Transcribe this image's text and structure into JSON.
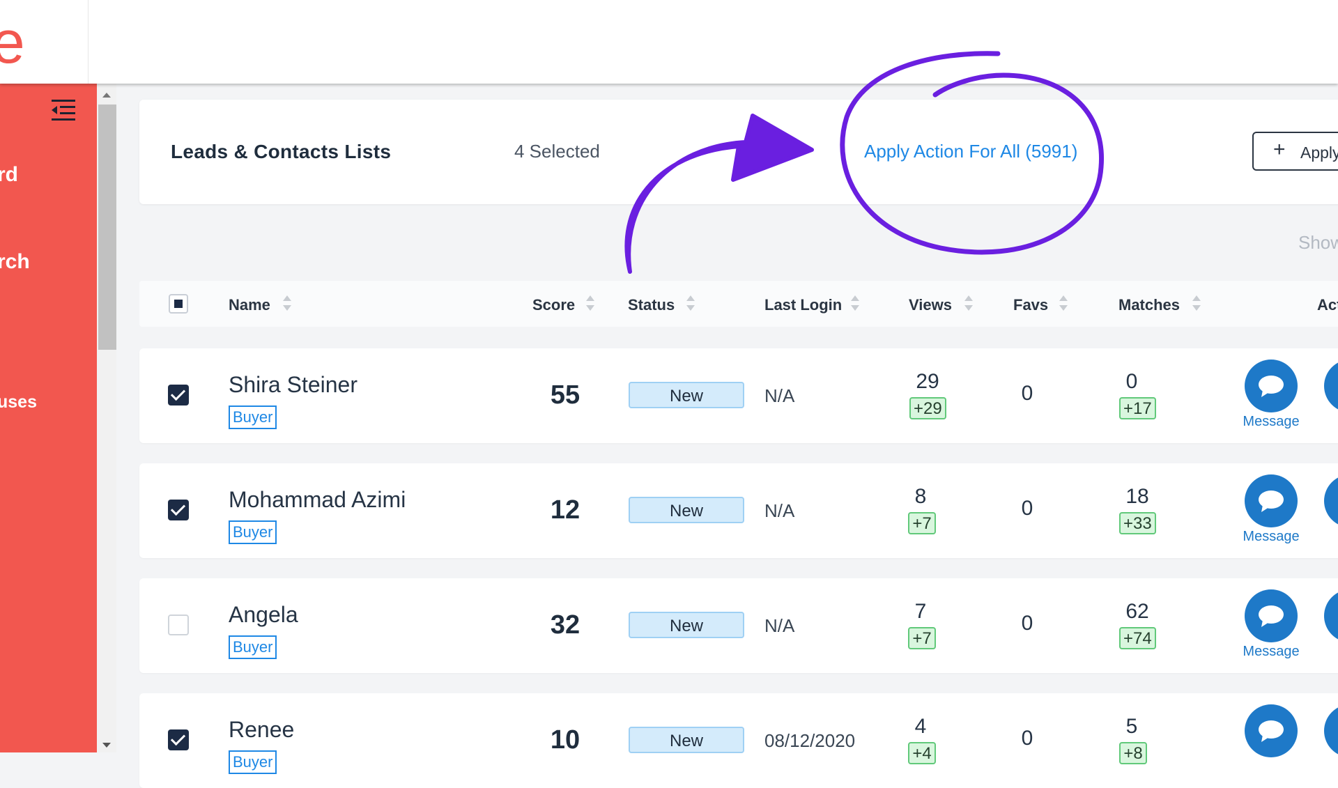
{
  "logo": {
    "text": "te"
  },
  "sidebar": {
    "items": [
      {
        "label": "rd"
      },
      {
        "label": "rch"
      },
      {
        "label": "uses"
      }
    ]
  },
  "header": {
    "title": "Leads & Contacts Lists",
    "selected": "4 Selected",
    "apply_all": "Apply Action For All (5991)",
    "apply_button": "Apply",
    "show": "Show"
  },
  "table": {
    "columns": [
      "Name",
      "Score",
      "Status",
      "Last Login",
      "Views",
      "Favs",
      "Matches",
      "Act"
    ],
    "message_label": "Message",
    "rows": [
      {
        "name": "Shira Steiner",
        "tag": "Buyer",
        "score": "55",
        "status": "New",
        "last_login": "N/A",
        "views": "29",
        "views_delta": "+29",
        "favs": "0",
        "matches": "0",
        "matches_delta": "+17",
        "checked": true
      },
      {
        "name": "Mohammad Azimi",
        "tag": "Buyer",
        "score": "12",
        "status": "New",
        "last_login": "N/A",
        "views": "8",
        "views_delta": "+7",
        "favs": "0",
        "matches": "18",
        "matches_delta": "+33",
        "checked": true
      },
      {
        "name": "Angela",
        "tag": "Buyer",
        "score": "32",
        "status": "New",
        "last_login": "N/A",
        "views": "7",
        "views_delta": "+7",
        "favs": "0",
        "matches": "62",
        "matches_delta": "+74",
        "checked": false
      },
      {
        "name": "Renee",
        "tag": "Buyer",
        "score": "10",
        "status": "New",
        "last_login": "08/12/2020",
        "views": "4",
        "views_delta": "+4",
        "favs": "0",
        "matches": "5",
        "matches_delta": "+8",
        "checked": true
      }
    ]
  },
  "colors": {
    "sidebar": "#f2574f",
    "accent": "#1e88e5",
    "annotation": "#6a1fe0"
  }
}
